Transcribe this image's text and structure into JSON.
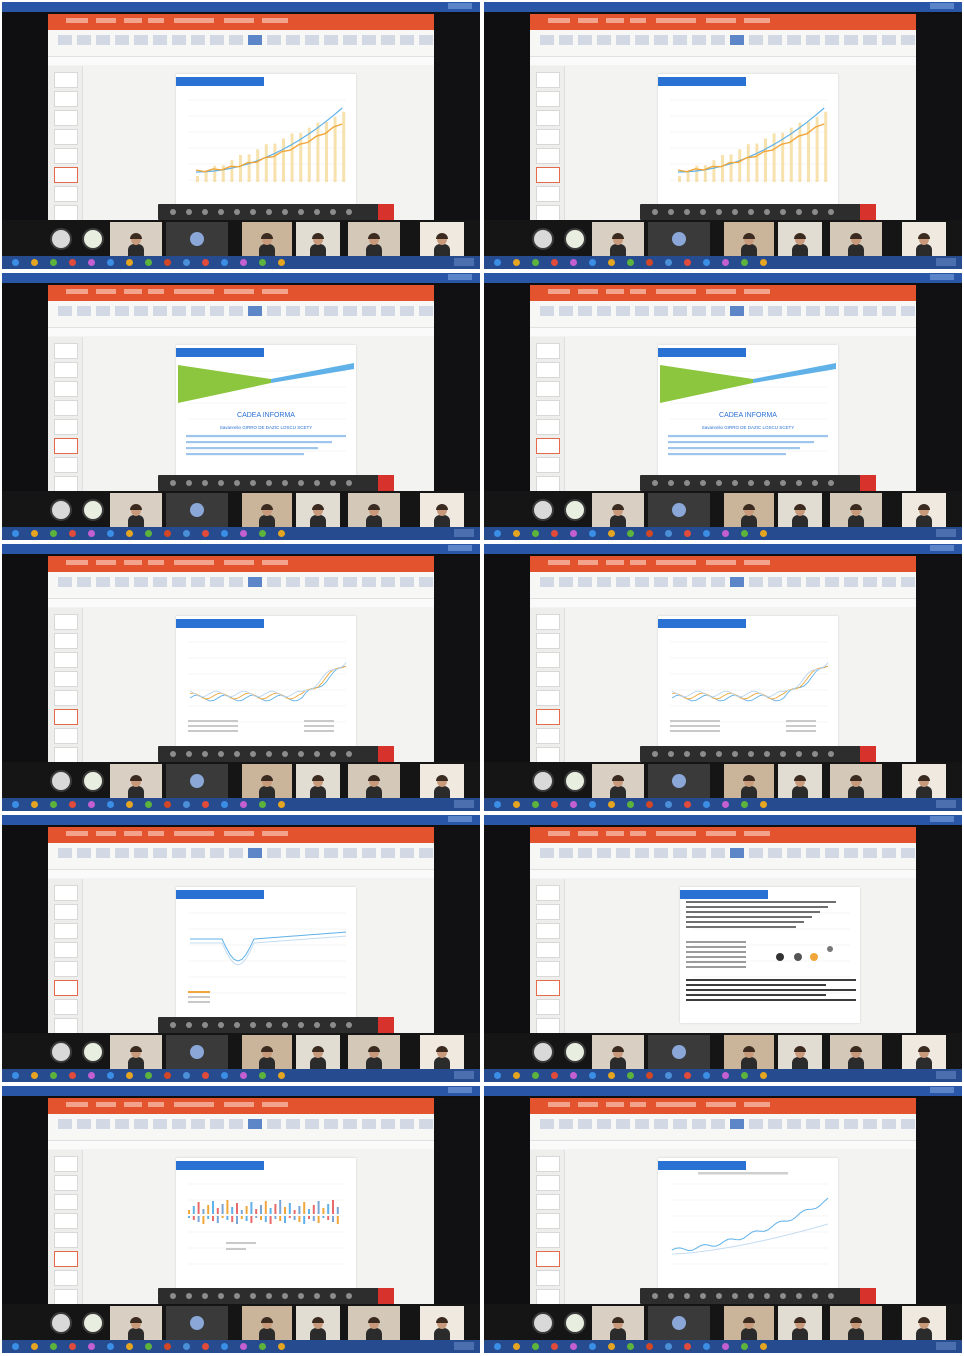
{
  "screen": {
    "title": ""
  },
  "panels": [
    {
      "id": "p1",
      "slide_type": "line-bar-chart",
      "title": "",
      "text_lines": []
    },
    {
      "id": "p2",
      "slide_type": "line-bar-chart",
      "title": "",
      "text_lines": []
    },
    {
      "id": "p3",
      "slide_type": "funnel-text",
      "title": "",
      "heading": "CADEA INFORMA",
      "sub": "Savanrelio GIRRO DE DAZIC LOSCU SCETY",
      "text_lines": []
    },
    {
      "id": "p4",
      "slide_type": "funnel-text",
      "title": "",
      "heading": "CADEA INFORMA",
      "sub": "Savanrelio GIRRO DE DAZIC LOSCU SCETY",
      "text_lines": []
    },
    {
      "id": "p5",
      "slide_type": "multi-line-chart",
      "title": "",
      "text_lines": []
    },
    {
      "id": "p6",
      "slide_type": "multi-line-chart",
      "title": "",
      "text_lines": []
    },
    {
      "id": "p7",
      "slide_type": "dip-line-chart",
      "title": "",
      "text_lines": []
    },
    {
      "id": "p8",
      "slide_type": "text-diagram",
      "title": "",
      "text_lines": []
    },
    {
      "id": "p9",
      "slide_type": "bar-cluster-chart",
      "title": "",
      "text_lines": []
    },
    {
      "id": "p10",
      "slide_type": "rising-line-chart",
      "title": "",
      "text_lines": []
    }
  ],
  "icons": {
    "presentation_toolbar": [
      "pen-icon",
      "pointer-icon",
      "zoom-icon",
      "settings-icon",
      "end-icon"
    ],
    "taskbar": [
      "start-icon",
      "browser-icon",
      "folder-icon",
      "chrome-icon",
      "powerpoint-icon",
      "teams-icon"
    ]
  },
  "colors": {
    "ribbon": "#e2532e",
    "slide_title_bar": "#2a71d4",
    "taskbar": "#274b8f",
    "end_button": "#d8322d",
    "chart_orange": "#f0a63a",
    "chart_blue": "#5fb1e8",
    "chart_green": "#8cc63e"
  }
}
